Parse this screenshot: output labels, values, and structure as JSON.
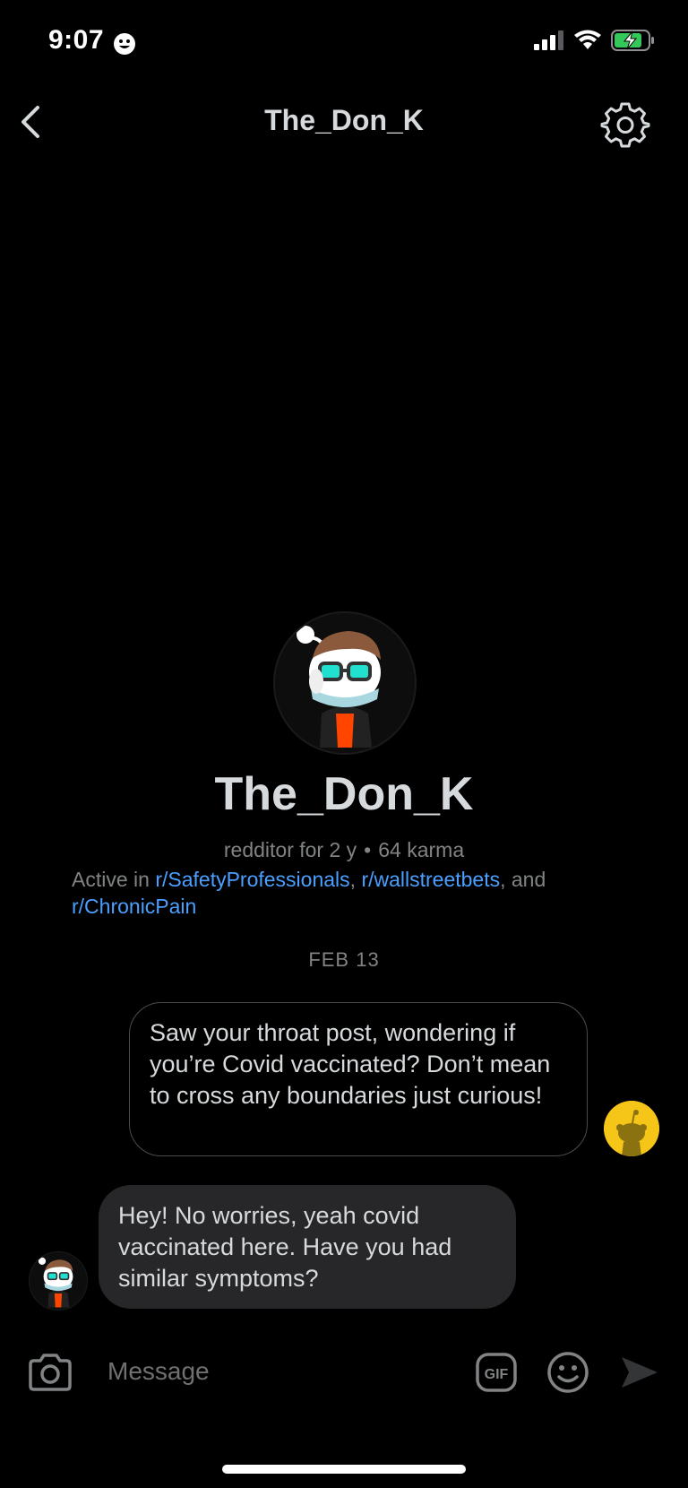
{
  "status_bar": {
    "time": "9:07",
    "emoji_icon": "smiley-face-icon",
    "signal_icon": "cellular-signal-icon",
    "wifi_icon": "wifi-icon",
    "battery_icon": "battery-charging-icon",
    "battery_color": "#34c759"
  },
  "header": {
    "title": "The_Don_K",
    "back_icon": "chevron-left-icon",
    "settings_icon": "gear-icon"
  },
  "profile": {
    "name": "The_Don_K",
    "age": "redditor for 2 y",
    "separator": "•",
    "karma": "64 karma",
    "active_prefix": "Active in",
    "subreddits": [
      "r/SafetyProfessionals",
      "r/wallstreetbets",
      "r/ChronicPain"
    ],
    "sep_comma": ",",
    "sep_and": ", and"
  },
  "chat": {
    "date_label": "FEB 13",
    "messages": [
      {
        "direction": "outgoing",
        "text": "Saw your throat post, wondering if you’re Covid vaccinated? Don’t mean to cross any boundaries just curious!"
      },
      {
        "direction": "incoming",
        "text": "Hey! No worries, yeah covid vaccinated here. Have you had similar symptoms?"
      }
    ]
  },
  "composer": {
    "placeholder": "Message",
    "camera_icon": "camera-icon",
    "gif_icon": "gif-icon",
    "gif_label": "GIF",
    "emoji_icon": "emoji-icon",
    "send_icon": "send-icon"
  },
  "colors": {
    "background": "#000000",
    "link": "#4a9fff",
    "incoming_bubble": "#272729",
    "self_avatar": "#f5c518"
  }
}
